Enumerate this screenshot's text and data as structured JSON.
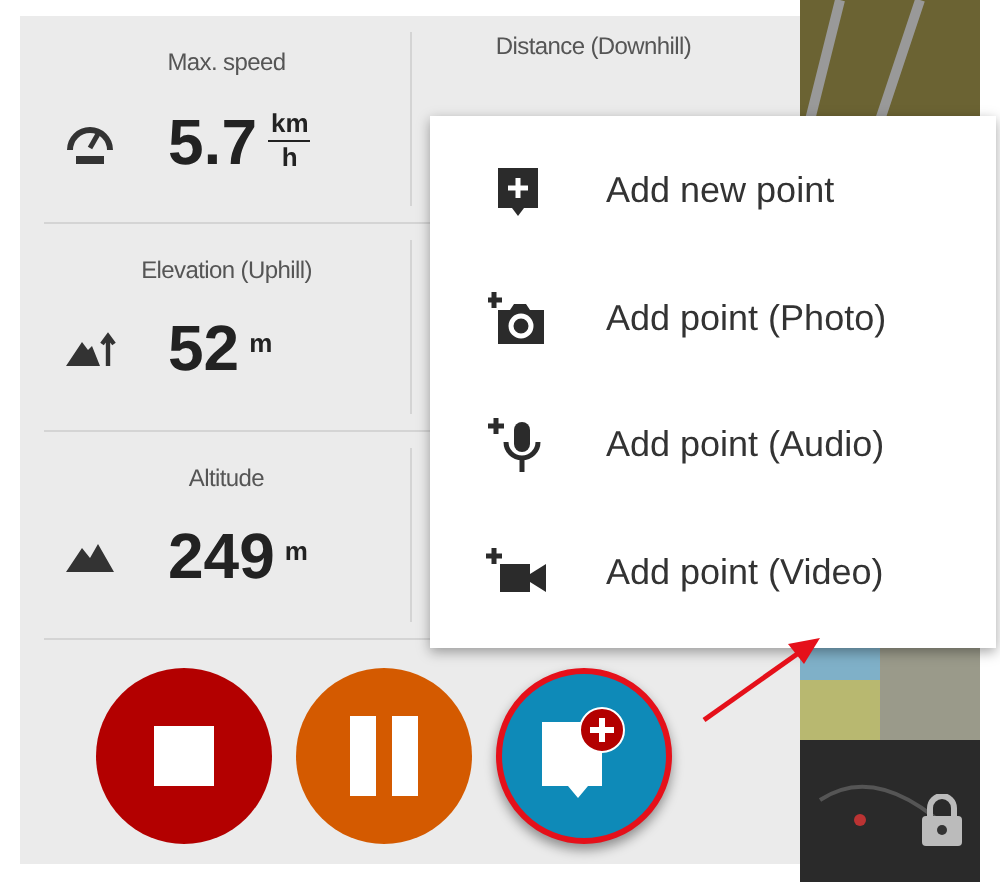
{
  "stats": [
    {
      "label": "Max. speed",
      "value": "5.7",
      "unit": "km",
      "unit_under": "h",
      "kind": "speed"
    },
    {
      "label": "Elevation (Uphill)",
      "value": "52",
      "unit": "m",
      "kind": "uphill"
    },
    {
      "label": "Altitude",
      "value": "249",
      "unit": "m",
      "kind": "altitude"
    }
  ],
  "stats_right": [
    {
      "label": "Distance (Downhill)"
    }
  ],
  "menu": [
    {
      "label": "Add new point",
      "kind": "point"
    },
    {
      "label": "Add point (Photo)"
    },
    {
      "label": "Add point (Audio)",
      "kind": "audio"
    },
    {
      "label": "Add point (Video)",
      "kind": "video"
    }
  ],
  "buttons": [
    {
      "kind": "stop"
    },
    {
      "kind": "pause"
    },
    {
      "kind": "add",
      "highlighted": true
    }
  ]
}
